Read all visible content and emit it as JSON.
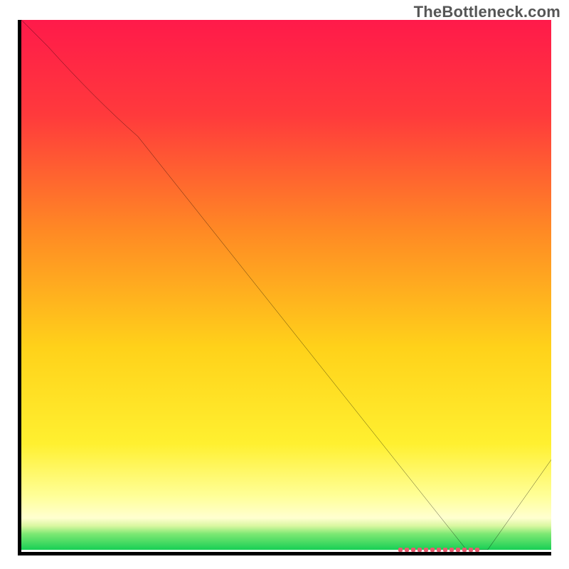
{
  "watermark": "TheBottleneck.com",
  "colors": {
    "border": "#000000",
    "watermark": "#565656",
    "gradient_stops": [
      {
        "offset": 0.0,
        "color": "#ff1a4a"
      },
      {
        "offset": 0.18,
        "color": "#ff3a3c"
      },
      {
        "offset": 0.4,
        "color": "#ff8a24"
      },
      {
        "offset": 0.62,
        "color": "#ffd21a"
      },
      {
        "offset": 0.8,
        "color": "#fff030"
      },
      {
        "offset": 0.9,
        "color": "#ffff9a"
      },
      {
        "offset": 0.94,
        "color": "#ffffd0"
      },
      {
        "offset": 0.955,
        "color": "#d9f7a0"
      },
      {
        "offset": 0.97,
        "color": "#7de873"
      },
      {
        "offset": 1.0,
        "color": "#18cf55"
      }
    ],
    "band": "#e85a70",
    "curve": "#000000"
  },
  "chart_data": {
    "type": "line",
    "title": "",
    "xlabel": "",
    "ylabel": "",
    "xlim": [
      0,
      100
    ],
    "ylim": [
      0,
      100
    ],
    "series": [
      {
        "name": "curve",
        "x": [
          0,
          5,
          14,
          22,
          84,
          86,
          88,
          100
        ],
        "values": [
          100,
          95,
          85,
          78,
          0,
          0,
          0,
          17
        ]
      }
    ],
    "highlight_band": {
      "x_start": 73,
      "x_end": 89,
      "y": 0
    }
  }
}
